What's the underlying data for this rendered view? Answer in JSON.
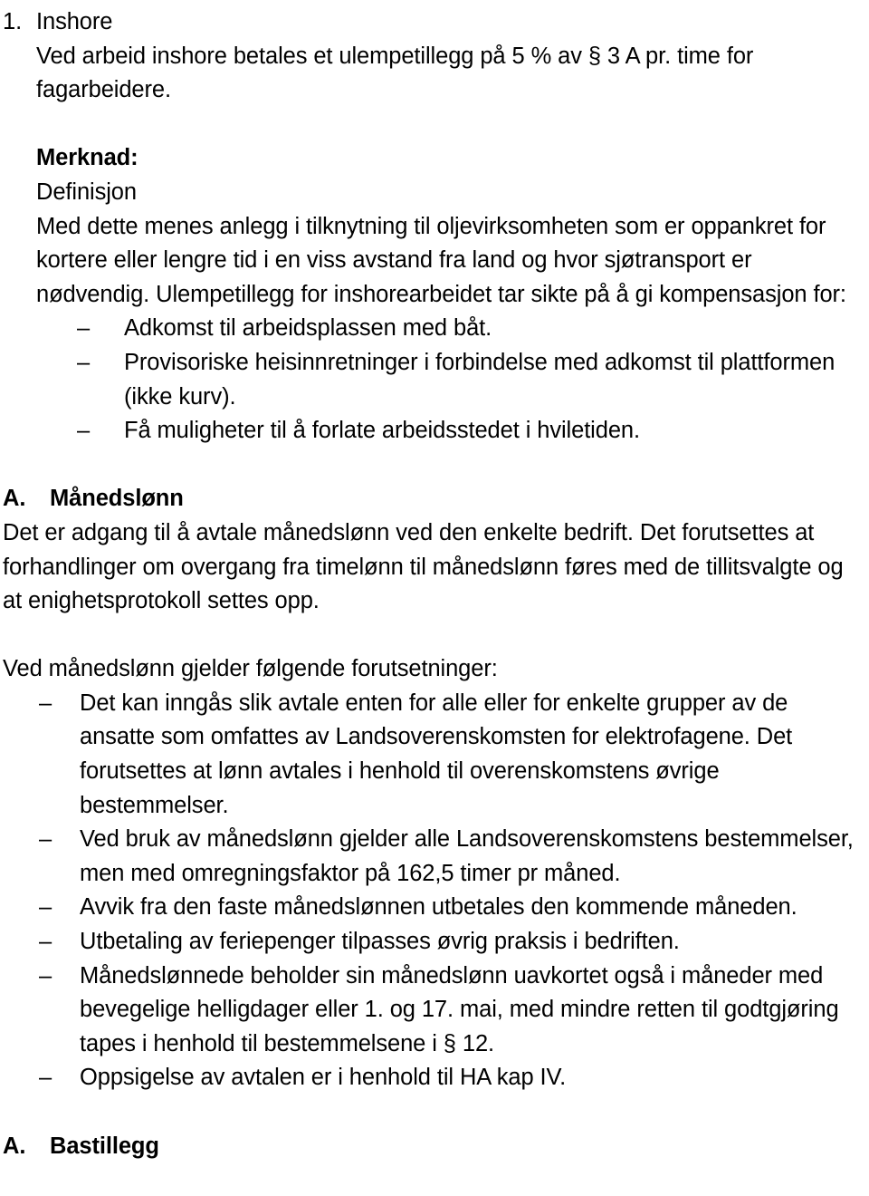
{
  "document": {
    "section_1": {
      "number": "1.",
      "title": "Inshore",
      "body": "Ved arbeid inshore betales et ulempetillegg på 5 % av § 3 A pr. time for fagarbeidere."
    },
    "merknad": {
      "heading": "Merknad:",
      "subheading": "Definisjon",
      "body": "Med dette menes anlegg i tilknytning til oljevirksomheten som er oppankret for kortere eller lengre tid i en viss avstand fra land og hvor sjøtransport er nødvendig. Ulempetillegg for inshorearbeidet tar sikte på å gi kompensasjon for:",
      "bullet_marker": "–",
      "bullets": [
        "Adkomst til arbeidsplassen med båt.",
        "Provisoriske heisinnretninger i forbindelse med adkomst til plattformen (ikke kurv).",
        "Få muligheter til å forlate arbeidsstedet i hviletiden."
      ]
    },
    "section_a_manedslonn": {
      "letter": "A.",
      "title": "Månedslønn",
      "body": "Det er adgang til å avtale månedslønn ved den enkelte bedrift. Det forutsettes at forhandlinger om overgang fra timelønn til månedslønn føres med de tillitsvalgte og at enighetsprotokoll settes opp.",
      "intro": "Ved månedslønn gjelder følgende forutsetninger:",
      "bullet_marker": "–",
      "bullets": [
        "Det kan inngås slik avtale enten for alle eller for enkelte grupper av de ansatte som omfattes av Landsoverenskomsten for elektrofagene. Det forutsettes at lønn avtales i henhold til overenskomstens øvrige bestemmelser.",
        "Ved bruk av månedslønn gjelder alle Landsoverenskomstens bestemmelser, men med omregningsfaktor på 162,5 timer pr måned.",
        "Avvik fra den faste månedslønnen utbetales den kommende måneden.",
        "Utbetaling av feriepenger tilpasses øvrig praksis i bedriften.",
        "Månedslønnede beholder sin månedslønn uavkortet også i måneder med bevegelige helligdager eller 1. og 17. mai, med mindre retten til godtgjøring tapes i henhold til bestemmelsene i § 12.",
        "Oppsigelse av avtalen er i henhold til HA kap IV."
      ]
    },
    "section_a_bastillegg": {
      "letter": "A.",
      "title": "Bastillegg"
    }
  }
}
